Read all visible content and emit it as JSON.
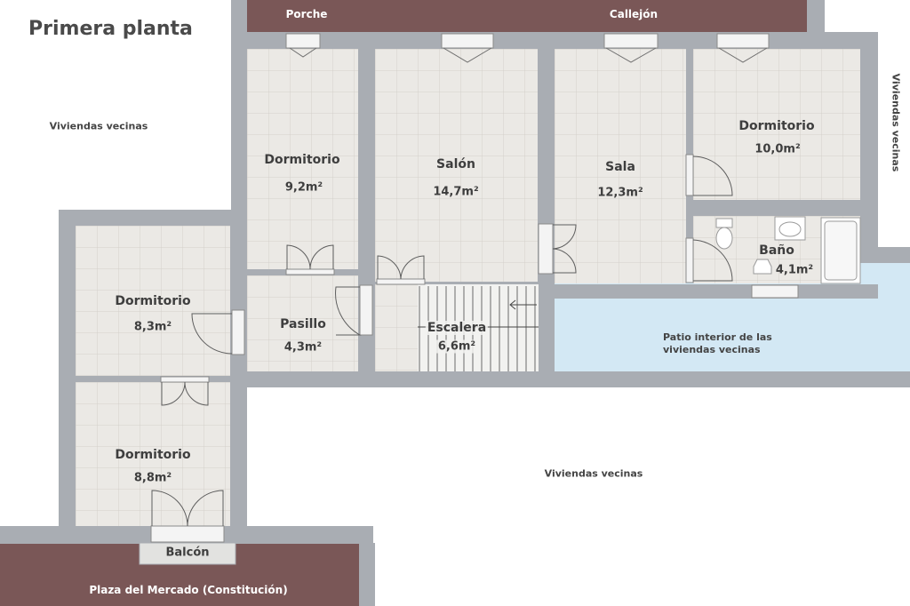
{
  "title": "Primera planta",
  "streets": {
    "porche": "Porche",
    "callejon": "Callejón",
    "plaza": "Plaza del Mercado (Constitución)"
  },
  "neighbors": {
    "left": "Viviendas vecinas",
    "right": "Viviendas vecinas",
    "bottom": "Viviendas vecinas"
  },
  "patio": {
    "line1": "Patio interior de las",
    "line2": "viviendas vecinas"
  },
  "balcony": "Balcón",
  "rooms": {
    "dorm1": {
      "name": "Dormitorio",
      "area": "9,2m²"
    },
    "salon": {
      "name": "Salón",
      "area": "14,7m²"
    },
    "sala": {
      "name": "Sala",
      "area": "12,3m²"
    },
    "dorm2": {
      "name": "Dormitorio",
      "area": "10,0m²"
    },
    "bano": {
      "name": "Baño",
      "area": "4,1m²"
    },
    "dorm3": {
      "name": "Dormitorio",
      "area": "8,3m²"
    },
    "pasillo": {
      "name": "Pasillo",
      "area": "4,3m²"
    },
    "escalera": {
      "name": "Escalera",
      "area": "6,6m²"
    },
    "dorm4": {
      "name": "Dormitorio",
      "area": "8,8m²"
    }
  },
  "colors": {
    "wall": "#a9adb3",
    "street": "#7a5757",
    "floor": "#ebe9e5",
    "patio": "#d3e8f4"
  }
}
